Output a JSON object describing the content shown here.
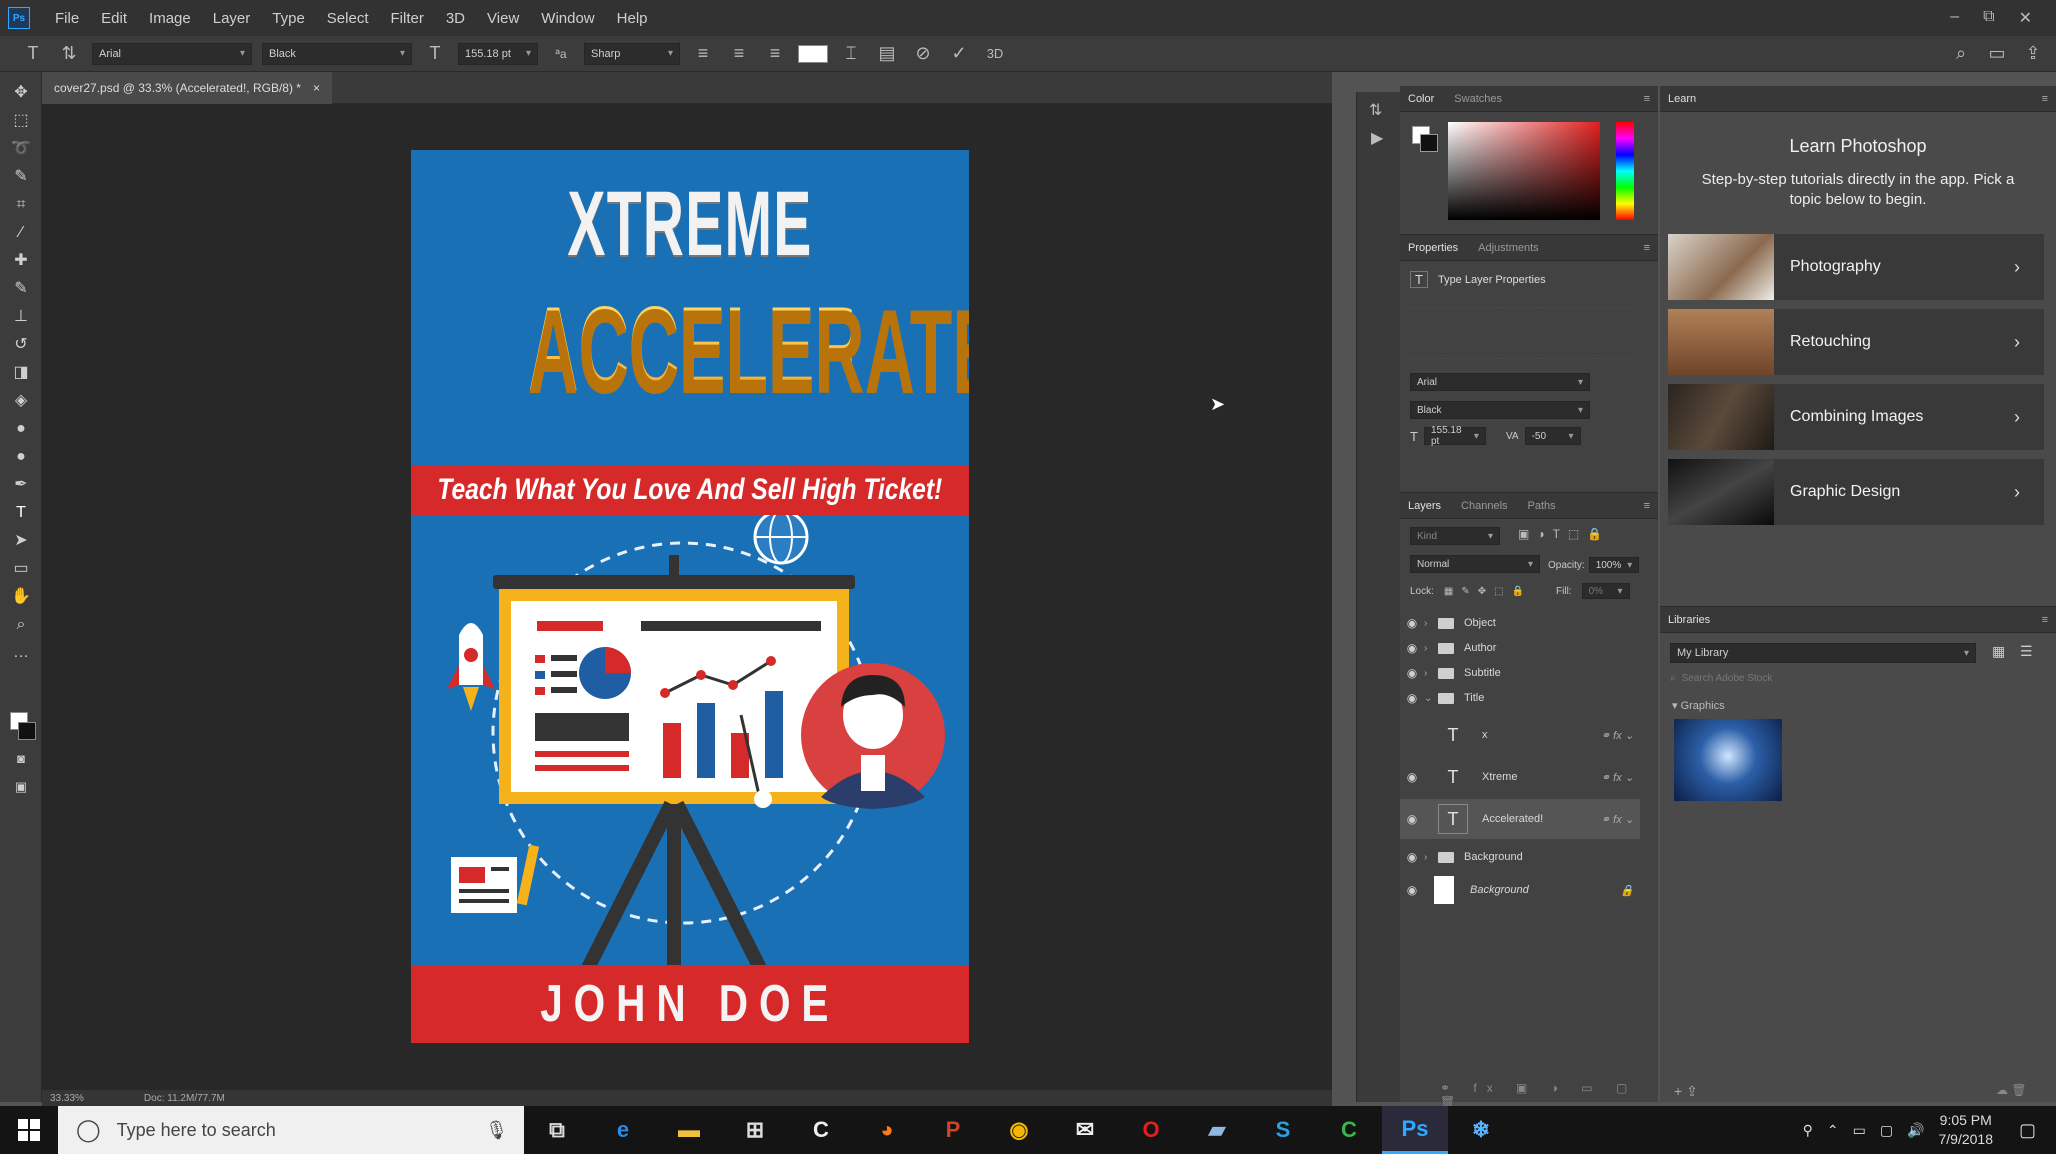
{
  "menubar": {
    "logo": "Ps",
    "items": [
      "File",
      "Edit",
      "Image",
      "Layer",
      "Type",
      "Select",
      "Filter",
      "3D",
      "View",
      "Window",
      "Help"
    ],
    "controls": [
      "–",
      "⧉",
      "✕"
    ]
  },
  "options": {
    "font_family": "Arial",
    "font_style": "Black",
    "font_size": "155.18 pt",
    "antialias": "Sharp"
  },
  "document": {
    "tab_title": "cover27.psd @ 33.3% (Accelerated!, RGB/8) *",
    "tab_close": "×",
    "status_zoom": "33.33%",
    "status_doc": "Doc: 11.2M/77.7M"
  },
  "cover": {
    "title_line1": "XTREME",
    "title_line2": "ACCELERATED",
    "subtitle": "Teach What You Love And Sell High Ticket!",
    "author": "JOHN DOE",
    "colors": {
      "background": "#1a70b5",
      "band": "#d62a2a",
      "gold": "#f6b21a"
    }
  },
  "color_panel": {
    "tabs": [
      "Color",
      "Swatches"
    ]
  },
  "properties_panel": {
    "tabs": [
      "Properties",
      "Adjustments"
    ],
    "heading": "Type Layer Properties",
    "font_family": "Arial",
    "font_style": "Black",
    "font_size": "155.18 pt",
    "tracking": "-50"
  },
  "layers_panel": {
    "tabs": [
      "Layers",
      "Channels",
      "Paths"
    ],
    "blend_mode": "Normal",
    "opacity_label": "Opacity:",
    "opacity": "100%",
    "lock_label": "Lock:",
    "fill_label": "Fill:",
    "fill": "0%",
    "kind_placeholder": "Kind",
    "layers": [
      {
        "name": "Object",
        "type": "group"
      },
      {
        "name": "Author",
        "type": "group"
      },
      {
        "name": "Subtitle",
        "type": "group"
      },
      {
        "name": "Title",
        "type": "group-open"
      },
      {
        "name": "x",
        "type": "text"
      },
      {
        "name": "Xtreme",
        "type": "text"
      },
      {
        "name": "Accelerated!",
        "type": "text"
      },
      {
        "name": "Background",
        "type": "group"
      },
      {
        "name": "Background",
        "type": "locked"
      }
    ]
  },
  "learn_panel": {
    "tab": "Learn",
    "title": "Learn Photoshop",
    "description": "Step-by-step tutorials directly in the app. Pick a topic below to begin.",
    "items": [
      "Photography",
      "Retouching",
      "Combining Images",
      "Graphic Design"
    ]
  },
  "libraries_panel": {
    "tab": "Libraries",
    "library": "My Library",
    "search_placeholder": "Search Adobe Stock",
    "section": "Graphics"
  },
  "taskbar": {
    "search_placeholder": "Type here to search",
    "time": "9:05 PM",
    "date": "7/9/2018"
  }
}
